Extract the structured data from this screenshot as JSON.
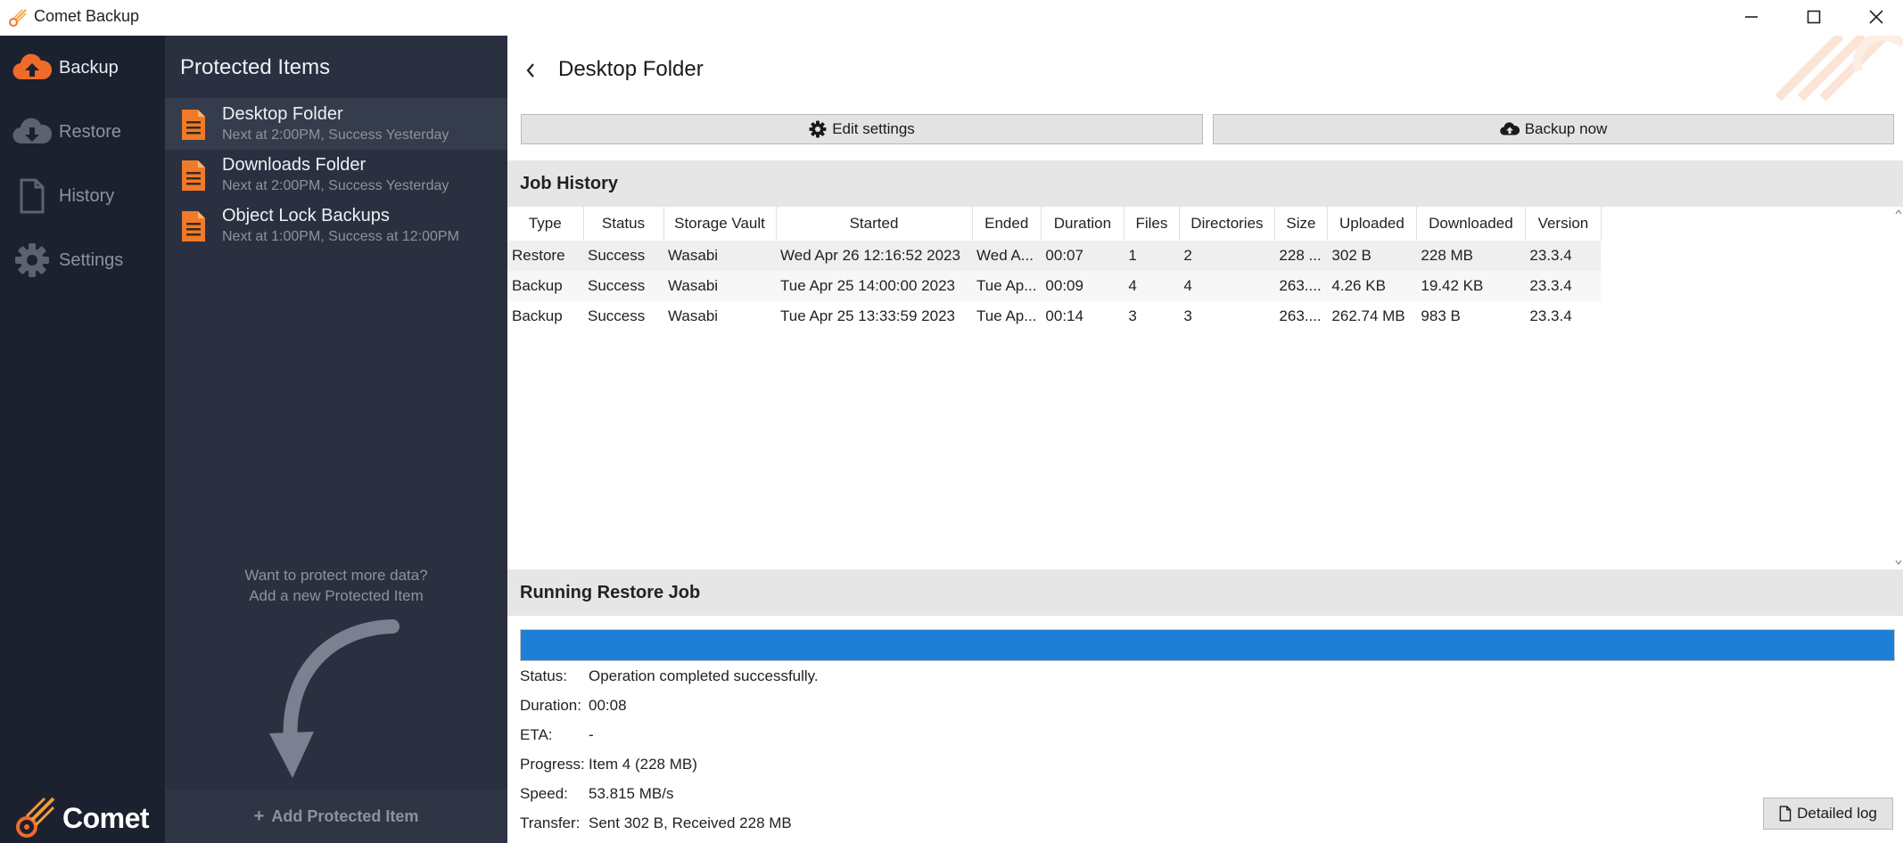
{
  "window": {
    "title": "Comet Backup"
  },
  "nav": {
    "items": [
      {
        "label": "Backup",
        "icon": "cloud-upload-icon",
        "active": true
      },
      {
        "label": "Restore",
        "icon": "cloud-download-icon",
        "active": false
      },
      {
        "label": "History",
        "icon": "document-icon",
        "active": false
      },
      {
        "label": "Settings",
        "icon": "gear-icon",
        "active": false
      }
    ],
    "logo_text": "Comet"
  },
  "protected_items": {
    "heading": "Protected Items",
    "items": [
      {
        "name": "Desktop Folder",
        "schedule": "Next at 2:00PM, Success Yesterday",
        "active": true
      },
      {
        "name": "Downloads Folder",
        "schedule": "Next at 2:00PM, Success Yesterday",
        "active": false
      },
      {
        "name": "Object Lock Backups",
        "schedule": "Next at 1:00PM, Success at 12:00PM",
        "active": false
      }
    ],
    "promo_line1": "Want to protect more data?",
    "promo_line2": "Add a new Protected Item",
    "add_label": "Add Protected Item"
  },
  "main": {
    "title": "Desktop Folder",
    "edit_settings_label": "Edit settings",
    "backup_now_label": "Backup now",
    "job_history": {
      "heading": "Job History",
      "columns": [
        "Type",
        "Status",
        "Storage Vault",
        "Started",
        "Ended",
        "Duration",
        "Files",
        "Directories",
        "Size",
        "Uploaded",
        "Downloaded",
        "Version"
      ],
      "rows": [
        [
          "Restore",
          "Success",
          "Wasabi",
          "Wed Apr 26 12:16:52 2023",
          "Wed A...",
          "00:07",
          "1",
          "2",
          "228 ...",
          "302 B",
          "228 MB",
          "23.3.4"
        ],
        [
          "Backup",
          "Success",
          "Wasabi",
          "Tue Apr 25 14:00:00 2023",
          "Tue Ap...",
          "00:09",
          "4",
          "4",
          "263....",
          "4.26 KB",
          "19.42 KB",
          "23.3.4"
        ],
        [
          "Backup",
          "Success",
          "Wasabi",
          "Tue Apr 25 13:33:59 2023",
          "Tue Ap...",
          "00:14",
          "3",
          "3",
          "263....",
          "262.74 MB",
          "983 B",
          "23.3.4"
        ]
      ]
    },
    "running_job": {
      "heading": "Running Restore Job",
      "progress_percent": 100,
      "progress_color": "#1e7fd6",
      "fields": [
        {
          "key": "Status:",
          "value": "Operation completed successfully."
        },
        {
          "key": "Duration:",
          "value": "00:08"
        },
        {
          "key": "ETA:",
          "value": "-"
        },
        {
          "key": "Progress:",
          "value": "Item 4 (228 MB)"
        },
        {
          "key": "Speed:",
          "value": "53.815 MB/s"
        },
        {
          "key": "Transfer:",
          "value": "Sent 302 B, Received 228 MB"
        }
      ],
      "detailed_log_label": "Detailed log"
    }
  },
  "colors": {
    "nav_bg": "#1c2130",
    "panel_bg": "#2a303f",
    "accent_orange": "#f47a2a",
    "progress_blue": "#1e7fd6"
  }
}
